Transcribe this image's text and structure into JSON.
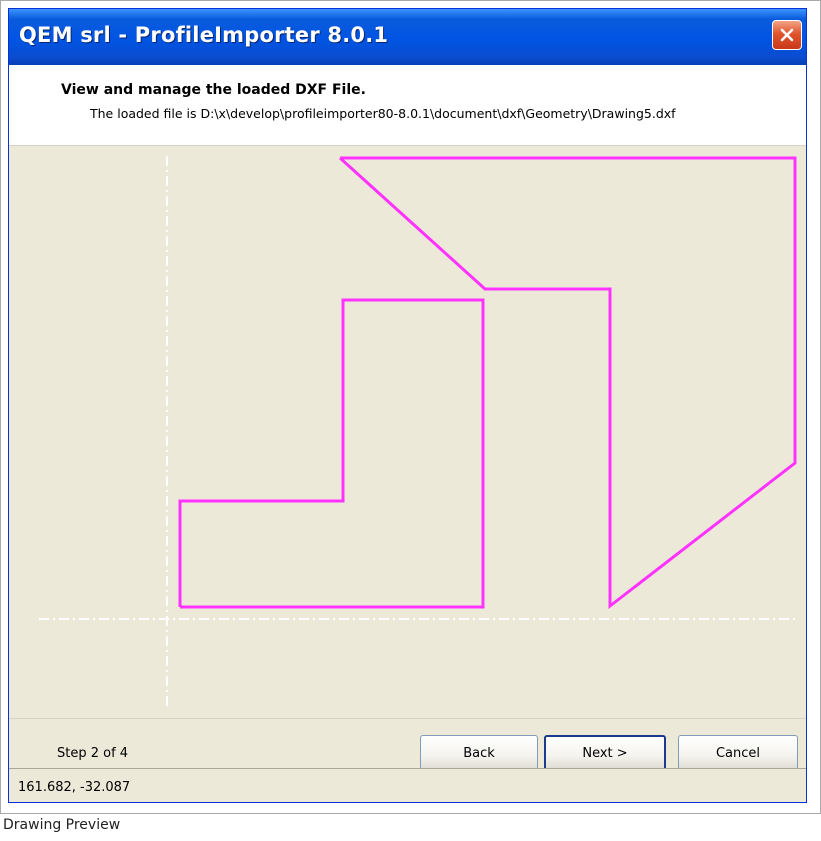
{
  "window": {
    "title": "QEM srl - ProfileImporter 8.0.1"
  },
  "header": {
    "title": "View and manage the loaded DXF File.",
    "subtitle": "The loaded file is D:\\x\\develop\\profileimporter80-8.0.1\\document\\dxf\\Geometry\\Drawing5.dxf"
  },
  "canvas": {
    "background_color": "#ece9d8",
    "shape_color": "#ff33ff",
    "axis_color": "#ffffff"
  },
  "footer": {
    "step_label": "Step 2 of 4",
    "back_label": "Back",
    "next_label": "Next >",
    "cancel_label": "Cancel"
  },
  "status": {
    "coordinates": "161.682, -32.087"
  },
  "caption": "Drawing Preview",
  "icons": {
    "close": "close-icon"
  }
}
